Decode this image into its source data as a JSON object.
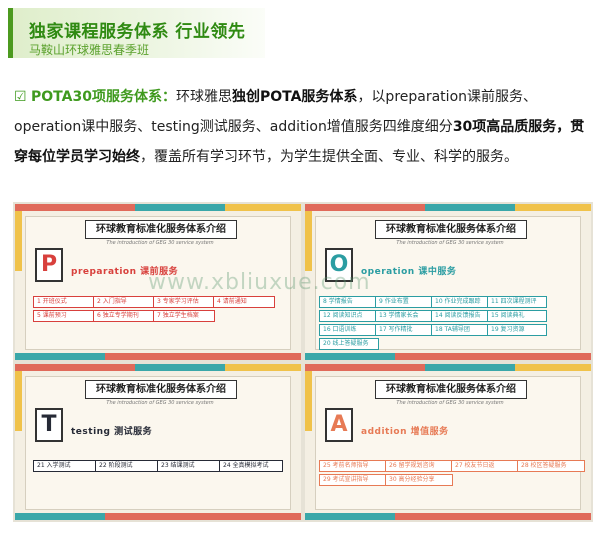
{
  "header": {
    "title": "独家课程服务体系 行业领先",
    "subtitle": "马鞍山环球雅思春季班"
  },
  "intro": {
    "check": "☑",
    "lead": "POTA30项服务体系：",
    "t1": "环球雅思",
    "b1": "独创POTA服务体系",
    "t2": "，以preparation课前服务、operation课中服务、testing测试服务、addition增值服务四维度细分",
    "b2": "30项高品质服务，贯穿每位学员学习始终",
    "t3": "，覆盖所有学习环节，为学生提供全面、专业、科学的服务。"
  },
  "watermark": "www.xbliuxue.com",
  "colors": {
    "green": "#3f9a1e",
    "p": "#d8403c",
    "o": "#2b9da2",
    "t": "#262a36",
    "a": "#e77a55"
  },
  "cards": [
    {
      "title": "环球教育标准化服务体系介绍",
      "sub": "The introduction of GEG 30 service system",
      "letter": "P",
      "code": "preparation 课前服务",
      "items": [
        "1 开班仪式",
        "2 入门指导",
        "3 专家学习评估",
        "4 请前通知",
        "5 课前预习",
        "6 独立专学期刊",
        "7 独立学生档案"
      ]
    },
    {
      "title": "环球教育标准化服务体系介绍",
      "sub": "The introduction of GEG 30 service system",
      "letter": "O",
      "code": "operation 课中服务",
      "items": [
        "8 学情报告",
        "9 作业布置",
        "10 作业完成跟踪",
        "11 四次课程测评",
        "12 阅读知识点",
        "13 学情家长会",
        "14 阅读反馈报告",
        "15 阅读典礼",
        "16 口语训练",
        "17 写作精批",
        "18 TA辅导团",
        "19 复习资源",
        "20 线上答疑服务"
      ]
    },
    {
      "title": "环球教育标准化服务体系介绍",
      "sub": "The introduction of GEG 30 service system",
      "letter": "T",
      "code": "testing 测试服务",
      "items": [
        "21 入学测试",
        "22 阶段测试",
        "23 结课测试",
        "24 全真模拟考试"
      ]
    },
    {
      "title": "环球教育标准化服务体系介绍",
      "sub": "The introduction of GEG 30 service system",
      "letter": "A",
      "code": "addition 增值服务",
      "items": [
        "25 考前名师指导",
        "26 留学规划咨询",
        "27 校友节日返",
        "28 校区答疑服务",
        "29 考试宣讲指导",
        "30 高分经验分享"
      ]
    }
  ]
}
